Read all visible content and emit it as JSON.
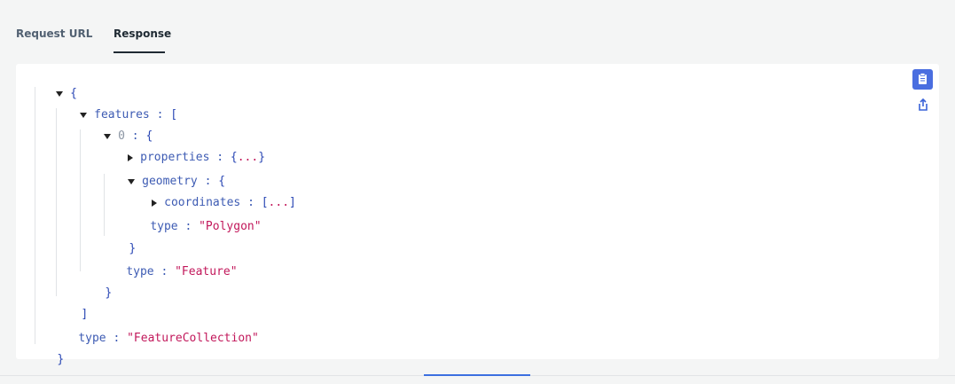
{
  "tabs": {
    "request_url": "Request URL",
    "response": "Response",
    "active": "Response"
  },
  "json_view": {
    "open_brace": "{",
    "close_brace": "}",
    "open_bracket": "[",
    "close_bracket": "]",
    "colon": ":",
    "ellipsis": "...",
    "keys": {
      "features": "features",
      "index0": "0",
      "properties": "properties",
      "geometry": "geometry",
      "coordinates": "coordinates",
      "type": "type"
    },
    "values": {
      "geometry_type": "\"Polygon\"",
      "feature_type": "\"Feature\"",
      "collection_type": "\"FeatureCollection\""
    }
  },
  "actions": {
    "copy_icon": "clipboard-icon",
    "share_icon": "share-icon"
  },
  "colors": {
    "accent": "#4a6ee0",
    "key": "#3d5bb3",
    "string": "#c2185b",
    "brace": "#2a47b4"
  }
}
